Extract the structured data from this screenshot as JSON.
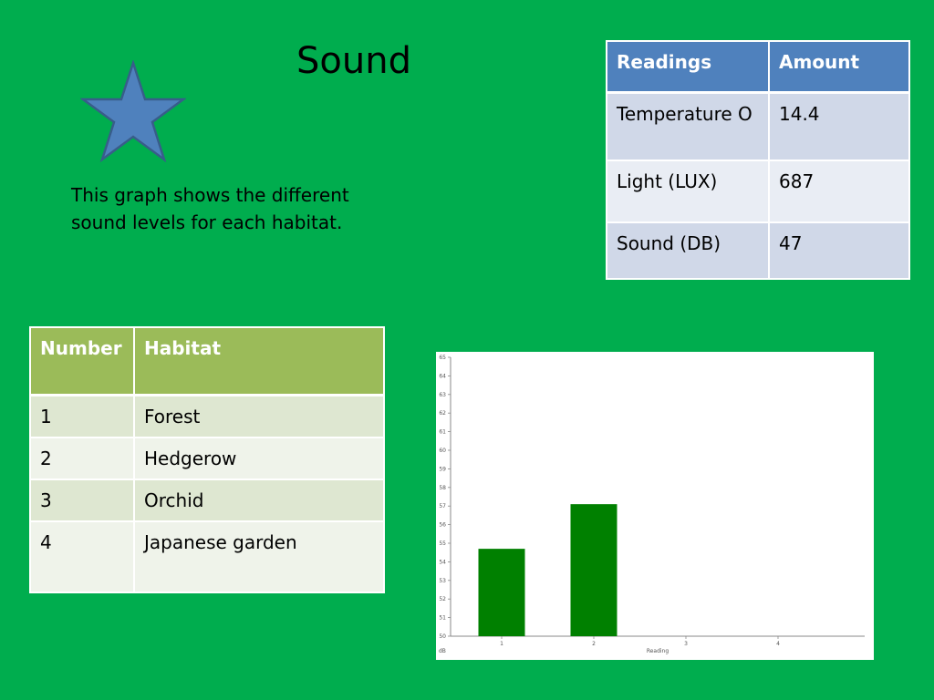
{
  "title": "Sound",
  "caption": "This graph shows the different sound levels for each habitat.",
  "icons": {
    "star": "star-icon"
  },
  "colors": {
    "background": "#00ad4e",
    "star_fill": "#4f81bd",
    "readings_header": "#4f81bd",
    "habitat_header": "#9bbb59",
    "bar": "#008000"
  },
  "readings_table": {
    "headers": [
      "Readings",
      "Amount"
    ],
    "rows": [
      [
        "Temperature O",
        "14.4"
      ],
      [
        "Light (LUX)",
        "687"
      ],
      [
        "Sound (DB)",
        "47"
      ]
    ]
  },
  "habitat_table": {
    "headers": [
      "Number",
      "Habitat"
    ],
    "rows": [
      [
        "1",
        "Forest"
      ],
      [
        "2",
        "Hedgerow"
      ],
      [
        "3",
        "Orchid"
      ],
      [
        "4",
        "Japanese garden"
      ]
    ]
  },
  "chart_data": {
    "type": "bar",
    "categories": [
      "1",
      "2",
      "3",
      "4"
    ],
    "values": [
      54.7,
      57.1,
      null,
      null
    ],
    "xlabel": "Reading",
    "ylabel": "dB",
    "ylim": [
      50,
      65
    ],
    "yticks": [
      50,
      51,
      52,
      53,
      54,
      55,
      56,
      57,
      58,
      59,
      60,
      61,
      62,
      63,
      64,
      65
    ],
    "grid": false,
    "color": "#008000"
  }
}
